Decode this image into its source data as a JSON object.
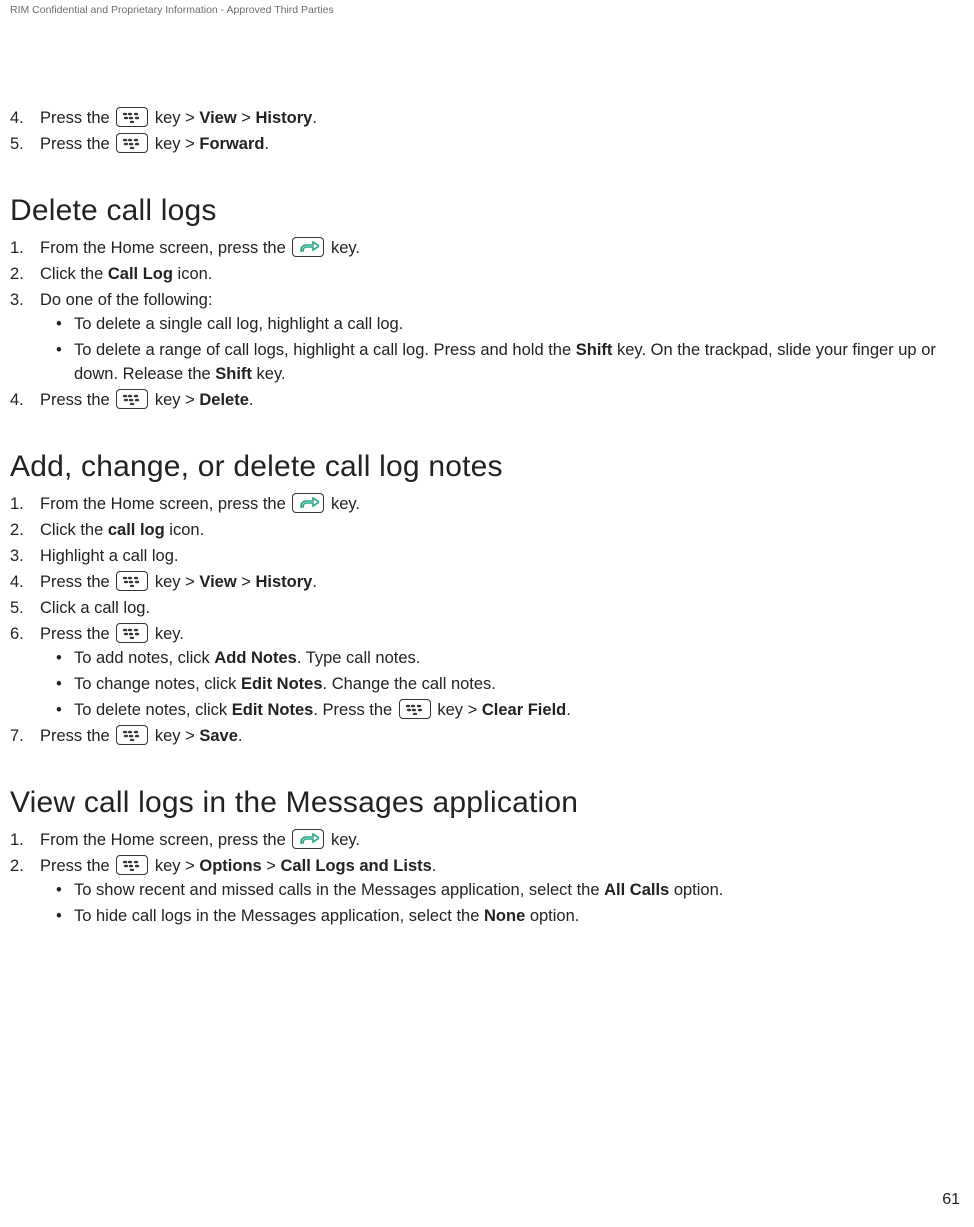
{
  "headerNote": "RIM Confidential and Proprietary Information - Approved Third Parties",
  "pageNumber": "61",
  "top": {
    "items": [
      {
        "num": "4.",
        "prefix": "Press the ",
        "iconType": "bb",
        "mid1": " key > ",
        "b1": "View",
        "mid2": " > ",
        "b2": "History",
        "suffix": "."
      },
      {
        "num": "5.",
        "prefix": "Press the ",
        "iconType": "bb",
        "mid1": " key > ",
        "b1": "Forward",
        "suffix": "."
      }
    ]
  },
  "sec1": {
    "heading": "Delete call logs",
    "li1": {
      "num": "1.",
      "prefix": "From the Home screen, press the ",
      "iconType": "send",
      "suffix": " key."
    },
    "li2": {
      "num": "2.",
      "t1": "Click the ",
      "b1": "Call Log",
      "t2": " icon."
    },
    "li3": {
      "num": "3.",
      "t1": "Do one of the following:"
    },
    "li3a": {
      "t1": "To delete a single call log, highlight a call log."
    },
    "li3b": {
      "t1": "To delete a range of call logs, highlight a call log. Press and hold the ",
      "b1": "Shift",
      "t2": " key. On the trackpad, slide your finger up or down. Release the ",
      "b2": "Shift",
      "t3": " key."
    },
    "li4": {
      "num": "4.",
      "prefix": "Press the ",
      "iconType": "bb",
      "mid1": " key > ",
      "b1": "Delete",
      "suffix": "."
    }
  },
  "sec2": {
    "heading": "Add, change, or delete call log notes",
    "li1": {
      "num": "1.",
      "prefix": "From the Home screen, press the ",
      "iconType": "send",
      "suffix": " key."
    },
    "li2": {
      "num": "2.",
      "t1": "Click the ",
      "b1": "call log",
      "t2": " icon."
    },
    "li3": {
      "num": "3.",
      "t1": "Highlight a call log."
    },
    "li4": {
      "num": "4.",
      "prefix": "Press the ",
      "iconType": "bb",
      "mid1": " key > ",
      "b1": "View",
      "mid2": " > ",
      "b2": "History",
      "suffix": "."
    },
    "li5": {
      "num": "5.",
      "t1": "Click a call log."
    },
    "li6": {
      "num": "6.",
      "prefix": "Press the ",
      "iconType": "bb",
      "suffix": " key."
    },
    "li6a": {
      "t1": "To add notes, click ",
      "b1": "Add Notes",
      "t2": ". Type call notes."
    },
    "li6b": {
      "t1": "To change notes, click ",
      "b1": "Edit Notes",
      "t2": ". Change the call notes."
    },
    "li6c": {
      "t1": "To delete notes, click ",
      "b1": "Edit Notes",
      "t2": ". Press the ",
      "iconType": "bb",
      "mid1": " key > ",
      "b2": "Clear Field",
      "t3": "."
    },
    "li7": {
      "num": "7.",
      "prefix": "Press the ",
      "iconType": "bb",
      "mid1": " key > ",
      "b1": "Save",
      "suffix": "."
    }
  },
  "sec3": {
    "heading": "View call logs in the Messages application",
    "li1": {
      "num": "1.",
      "prefix": "From the Home screen, press the ",
      "iconType": "send",
      "suffix": " key."
    },
    "li2": {
      "num": "2.",
      "prefix": "Press the ",
      "iconType": "bb",
      "mid1": " key > ",
      "b1": "Options",
      "mid2": " > ",
      "b2": "Call Logs and Lists",
      "suffix": "."
    },
    "li2a": {
      "t1": "To show recent and missed calls in the Messages application, select the ",
      "b1": "All Calls",
      "t2": " option."
    },
    "li2b": {
      "t1": "To hide call logs in the Messages application, select the ",
      "b1": "None",
      "t2": " option."
    }
  }
}
